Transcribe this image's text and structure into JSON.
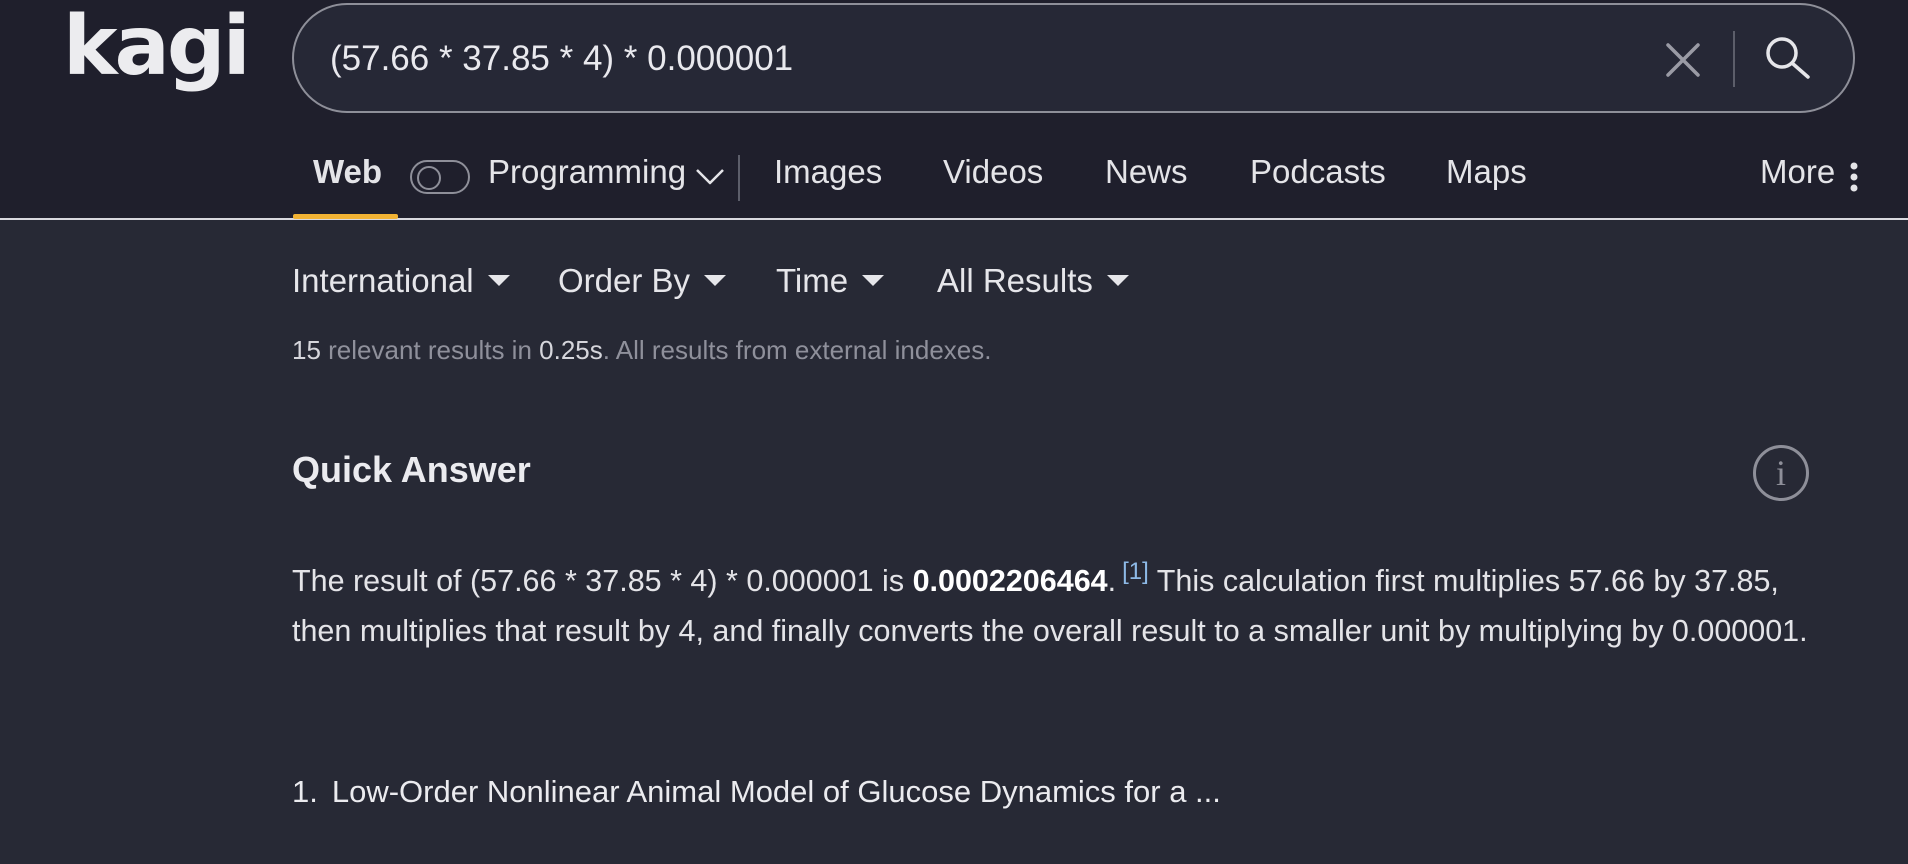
{
  "app": {
    "logo_text": "kagi"
  },
  "search": {
    "query": "(57.66 * 37.85 * 4) * 0.000001"
  },
  "nav": {
    "web": "Web",
    "lens": "Programming",
    "images": "Images",
    "videos": "Videos",
    "news": "News",
    "podcasts": "Podcasts",
    "maps": "Maps",
    "more": "More"
  },
  "filters": {
    "region": "International",
    "order": "Order By",
    "time": "Time",
    "results": "All Results"
  },
  "stats": {
    "count": "15",
    "text1": " relevant results in ",
    "time": "0.25s",
    "text2": ". All results from external indexes."
  },
  "quick_answer": {
    "title": "Quick Answer",
    "info_icon_text": "i",
    "text_before": "The result of (57.66 * 37.85 * 4) * 0.000001 is ",
    "result": "0.0002206464",
    "period": ".",
    "citation": "[1]",
    "text_after": " This calculation first multiplies 57.66 by 37.85, then multiplies that result by 4, and finally converts the overall result to a smaller unit by multiplying by 0.000001."
  },
  "results": [
    {
      "number": "1.",
      "title": "Low-Order Nonlinear Animal Model of Glucose Dynamics for a ..."
    }
  ],
  "colors": {
    "background": "#272935",
    "header": "#1f1f2c",
    "accent": "#f2b334",
    "citation": "#8db9e6"
  }
}
